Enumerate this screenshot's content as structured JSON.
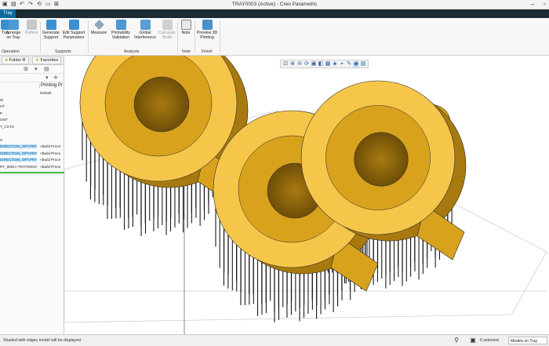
{
  "window": {
    "title": "TRAY0003 (Active) - Creo Parametric"
  },
  "ribbon": {
    "active_tab": "Tray",
    "buttons": [
      {
        "label": "Tray",
        "icon": "tray-icon"
      },
      {
        "label": "Arrange on Tray",
        "icon": "arrange-icon"
      },
      {
        "label": "Pattern",
        "icon": "pattern-icon",
        "disabled": true
      },
      {
        "label": "Generate Support",
        "icon": "support-icon"
      },
      {
        "label": "Edit Support Parameters",
        "icon": "edit-support-icon"
      },
      {
        "label": "Measure",
        "icon": "measure-icon"
      },
      {
        "label": "Printability Validation",
        "icon": "printability-icon"
      },
      {
        "label": "Global Interference",
        "icon": "interference-icon"
      },
      {
        "label": "Calculate Build",
        "icon": "calculate-icon",
        "disabled": true
      },
      {
        "label": "Note",
        "icon": "note-icon"
      },
      {
        "label": "Preview 3D Printing",
        "icon": "preview-icon"
      }
    ],
    "groups": [
      "Operation",
      "Supports",
      "Analysis",
      "Note",
      "Finish"
    ]
  },
  "left_panel": {
    "tabs": [
      "Folder B",
      "Favorites"
    ],
    "columns": [
      "",
      "Printing Pr"
    ],
    "rows": [
      {
        "name": "",
        "prop": "Default"
      },
      {
        "name": "M",
        "prop": ""
      },
      {
        "name": "HT",
        "prop": ""
      },
      {
        "name": "P",
        "prop": ""
      },
      {
        "name": "ONT",
        "prop": ""
      },
      {
        "name": "T_CSYS",
        "prop": ""
      },
      {
        "name": "",
        "prop": ""
      },
      {
        "name": "S",
        "prop": ""
      },
      {
        "name": "DIRECTION_OPT.PRT",
        "prop": "<Build Proce",
        "selected": true
      },
      {
        "name": "DIRECTION_OPT.PRT",
        "prop": "<Build Proce",
        "selected": true
      },
      {
        "name": "DIRECTION_OPT.PRT",
        "prop": "<Build Proce",
        "selected": true
      },
      {
        "name": "RT_0001<-TRAY0003>",
        "prop": "<Build Proce"
      }
    ]
  },
  "status": {
    "message": "Shaded with edges model will be displayed",
    "selected": "0 selected",
    "filter": "Models on Tray"
  },
  "colors": {
    "part_light": "#f6c64a",
    "part_mid": "#d9a21c",
    "part_dark": "#a8790f",
    "part_edge": "#2a2a2a",
    "tab_accent": "#0b6b9c"
  }
}
